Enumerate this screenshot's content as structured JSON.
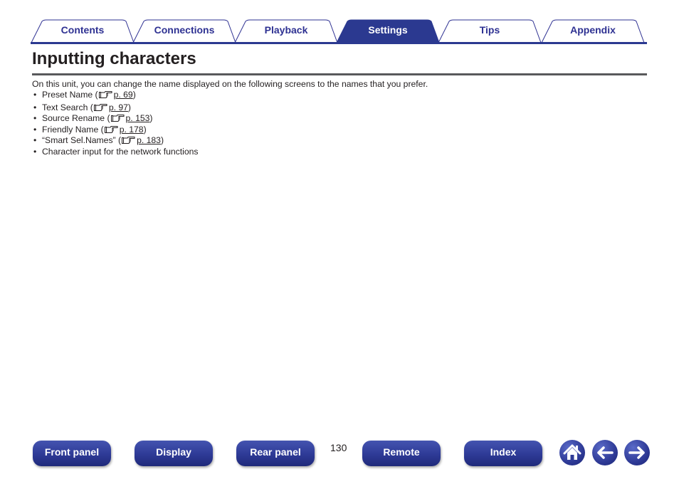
{
  "tabs": [
    {
      "label": "Contents",
      "active": false
    },
    {
      "label": "Connections",
      "active": false
    },
    {
      "label": "Playback",
      "active": false
    },
    {
      "label": "Settings",
      "active": true
    },
    {
      "label": "Tips",
      "active": false
    },
    {
      "label": "Appendix",
      "active": false
    }
  ],
  "colors": {
    "brand": "#2e3192",
    "active_tab": "#2b3990",
    "title_rule": "#58595b"
  },
  "page": {
    "title": "Inputting characters",
    "intro": "On this unit, you can change the name displayed on the following screens to the names that you prefer.",
    "items": [
      {
        "text": "Preset Name ",
        "pre": "(",
        "icon": "pointing-hand-icon",
        "ref": "p. 69",
        "post": ")"
      },
      {
        "text": "Text Search ",
        "pre": "(",
        "icon": "pointing-hand-icon",
        "ref": "p. 97",
        "post": ")"
      },
      {
        "text": "Source Rename ",
        "pre": "(",
        "icon": "pointing-hand-icon",
        "ref": "p. 153",
        "post": ")"
      },
      {
        "text": "Friendly Name ",
        "pre": "(",
        "icon": "pointing-hand-icon",
        "ref": "p. 178",
        "post": ")"
      },
      {
        "text": "“Smart Sel.Names” ",
        "pre": "(",
        "icon": "pointing-hand-icon",
        "ref": "p. 183",
        "post": ")"
      },
      {
        "text": "Character input for the network functions"
      }
    ]
  },
  "footer": {
    "buttons": [
      "Front panel",
      "Display",
      "Rear panel",
      "Remote",
      "Index"
    ],
    "page_number": "130",
    "icons": [
      "home-icon",
      "arrow-left-icon",
      "arrow-right-icon"
    ]
  }
}
